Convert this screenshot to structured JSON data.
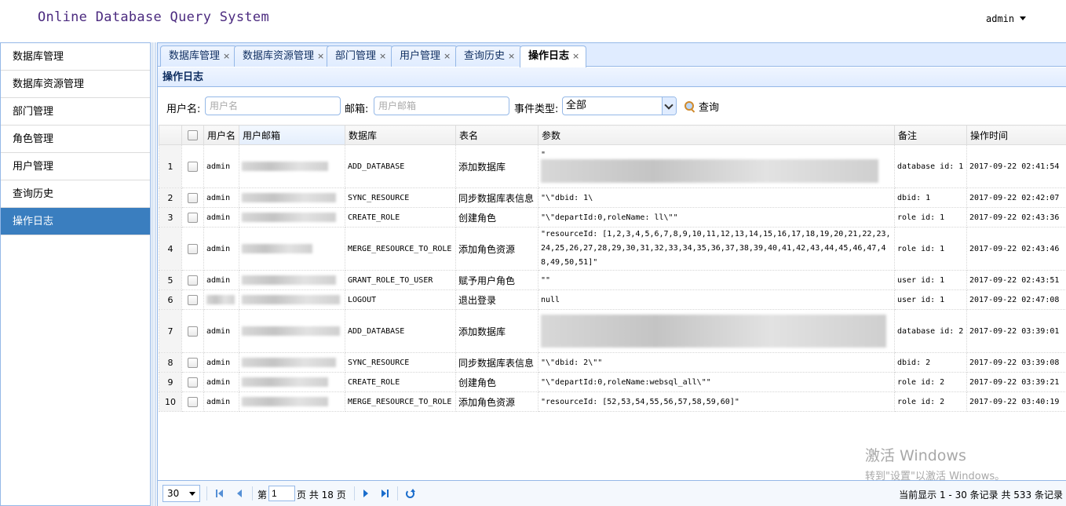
{
  "header": {
    "title": "Online Database Query System",
    "user": "admin"
  },
  "sidebar": {
    "items": [
      {
        "label": "数据库管理"
      },
      {
        "label": "数据库资源管理"
      },
      {
        "label": "部门管理"
      },
      {
        "label": "角色管理"
      },
      {
        "label": "用户管理"
      },
      {
        "label": "查询历史"
      },
      {
        "label": "操作日志",
        "active": true
      }
    ]
  },
  "tabs": [
    {
      "label": "数据库管理"
    },
    {
      "label": "数据库资源管理"
    },
    {
      "label": "部门管理"
    },
    {
      "label": "用户管理"
    },
    {
      "label": "查询历史"
    },
    {
      "label": "操作日志",
      "active": true
    }
  ],
  "tab_close": "×",
  "panel": {
    "title": "操作日志"
  },
  "filters": {
    "username_label": "用户名:",
    "username_placeholder": "用户名",
    "email_label": "邮箱:",
    "email_placeholder": "用户邮箱",
    "event_label": "事件类型:",
    "event_value": "全部",
    "search_label": "查询"
  },
  "grid": {
    "columns": [
      "用户名",
      "用户邮箱",
      "数据库",
      "表名",
      "参数",
      "备注",
      "操作时间"
    ],
    "rows": [
      {
        "n": "1",
        "user": "admin",
        "event": "ADD_DATABASE",
        "table": "添加数据库",
        "params": "\"",
        "note": "database id: 1",
        "time": "2017-09-22 02:41:54"
      },
      {
        "n": "2",
        "user": "admin",
        "event": "SYNC_RESOURCE",
        "table": "同步数据库表信息",
        "params": "\"\\\"dbid: 1\\",
        "note": "dbid: 1",
        "time": "2017-09-22 02:42:07"
      },
      {
        "n": "3",
        "user": "admin",
        "event": "CREATE_ROLE",
        "table": "创建角色",
        "params": "\"\\\"departId:0,roleName:      ll\\\"\"",
        "note": "role id: 1",
        "time": "2017-09-22 02:43:36"
      },
      {
        "n": "4",
        "user": "admin",
        "event": "MERGE_RESOURCE_TO_ROLE",
        "table": "添加角色资源",
        "params": "\"resourceId: [1,2,3,4,5,6,7,8,9,10,11,12,13,14,15,16,17,18,19,20,21,22,23,24,25,26,27,28,29,30,31,32,33,34,35,36,37,38,39,40,41,42,43,44,45,46,47,48,49,50,51]\"",
        "note": "role id: 1",
        "time": "2017-09-22 02:43:46"
      },
      {
        "n": "5",
        "user": "admin",
        "event": "GRANT_ROLE_TO_USER",
        "table": "赋予用户角色",
        "params": "\"\"",
        "note": "user id: 1",
        "time": "2017-09-22 02:43:51"
      },
      {
        "n": "6",
        "user": "",
        "event": "LOGOUT",
        "table": "退出登录",
        "params": "null",
        "note": "user id: 1",
        "time": "2017-09-22 02:47:08"
      },
      {
        "n": "7",
        "user": "admin",
        "event": "ADD_DATABASE",
        "table": "添加数据库",
        "params": "",
        "note": "database id: 2",
        "time": "2017-09-22 03:39:01"
      },
      {
        "n": "8",
        "user": "admin",
        "event": "SYNC_RESOURCE",
        "table": "同步数据库表信息",
        "params": "\"\\\"dbid: 2\\\"\"",
        "note": "dbid: 2",
        "time": "2017-09-22 03:39:08"
      },
      {
        "n": "9",
        "user": "admin",
        "event": "CREATE_ROLE",
        "table": "创建角色",
        "params": "\"\\\"departId:0,roleName:websql_all\\\"\"",
        "note": "role id: 2",
        "time": "2017-09-22 03:39:21"
      },
      {
        "n": "10",
        "user": "admin",
        "event": "MERGE_RESOURCE_TO_ROLE",
        "table": "添加角色资源",
        "params": "\"resourceId: [52,53,54,55,56,57,58,59,60]\"",
        "note": "role id: 2",
        "time": "2017-09-22 03:40:19"
      }
    ]
  },
  "pager": {
    "page_size": "30",
    "page_prefix": "第",
    "page_value": "1",
    "page_suffix": "页 共 18 页",
    "info": "当前显示 1 - 30 条记录 共 533 条记录"
  },
  "watermark": {
    "line1": "激活 Windows",
    "line2": "转到\"设置\"以激活 Windows。"
  },
  "colors": {
    "accent": "#3a7ebf",
    "border": "#95b8e7",
    "title": "#4b2a7f"
  }
}
